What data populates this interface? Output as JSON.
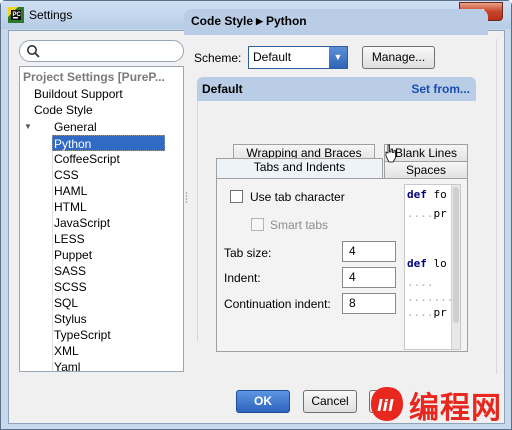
{
  "window": {
    "title": "Settings",
    "close_glyph": "x"
  },
  "search": {
    "placeholder": "",
    "icon": "search-icon"
  },
  "tree": {
    "header": "Project Settings [PureP...",
    "items": [
      {
        "label": "Buildout Support"
      },
      {
        "label": "Code Style"
      },
      {
        "label": "General"
      },
      {
        "label": "Python"
      },
      {
        "label": "CoffeeScript"
      },
      {
        "label": "CSS"
      },
      {
        "label": "HAML"
      },
      {
        "label": "HTML"
      },
      {
        "label": "JavaScript"
      },
      {
        "label": "LESS"
      },
      {
        "label": "Puppet"
      },
      {
        "label": "SASS"
      },
      {
        "label": "SCSS"
      },
      {
        "label": "SQL"
      },
      {
        "label": "Stylus"
      },
      {
        "label": "TypeScript"
      },
      {
        "label": "XML"
      },
      {
        "label": "Yaml"
      }
    ],
    "selected": "Python"
  },
  "breadcrumb": {
    "parent": "Code Style",
    "current": "Python",
    "separator": "▶"
  },
  "scheme": {
    "label": "Scheme:",
    "value": "Default",
    "manage_label": "Manage..."
  },
  "section": {
    "title": "Default",
    "set_from": "Set from..."
  },
  "tabs": [
    {
      "label": "Wrapping and Braces"
    },
    {
      "label": "Blank Lines"
    },
    {
      "label": "Tabs and Indents"
    },
    {
      "label": "Spaces"
    }
  ],
  "active_tab": "Tabs and Indents",
  "options": {
    "use_tab": {
      "label": "Use tab character",
      "checked": false
    },
    "smart_tabs": {
      "label": "Smart tabs",
      "checked": false,
      "enabled": false
    }
  },
  "fields": {
    "tab_size": {
      "label": "Tab size:",
      "value": "4"
    },
    "indent": {
      "label": "Indent:",
      "value": "4"
    },
    "continuation": {
      "label": "Continuation indent:",
      "value": "8"
    }
  },
  "preview": {
    "lines": [
      {
        "kw": "def",
        "rest": " fo"
      },
      {
        "dots": "....",
        "rest": "pr"
      },
      {
        "dots": "",
        "rest": ""
      },
      {
        "dots": "",
        "rest": ""
      },
      {
        "kw": "def",
        "rest": " lo"
      },
      {
        "dots": "....",
        "rest": ""
      },
      {
        "dots": "........",
        "rest": ""
      },
      {
        "dots": "....",
        "rest": "pr"
      }
    ]
  },
  "buttons": {
    "ok": "OK",
    "cancel": "Cancel"
  },
  "watermark": {
    "text": "编程网"
  },
  "colors": {
    "accent": "#316ac5",
    "header_bar": "#b9cde6",
    "set_from": "#1a4fb0",
    "watermark": "#e8281e"
  }
}
